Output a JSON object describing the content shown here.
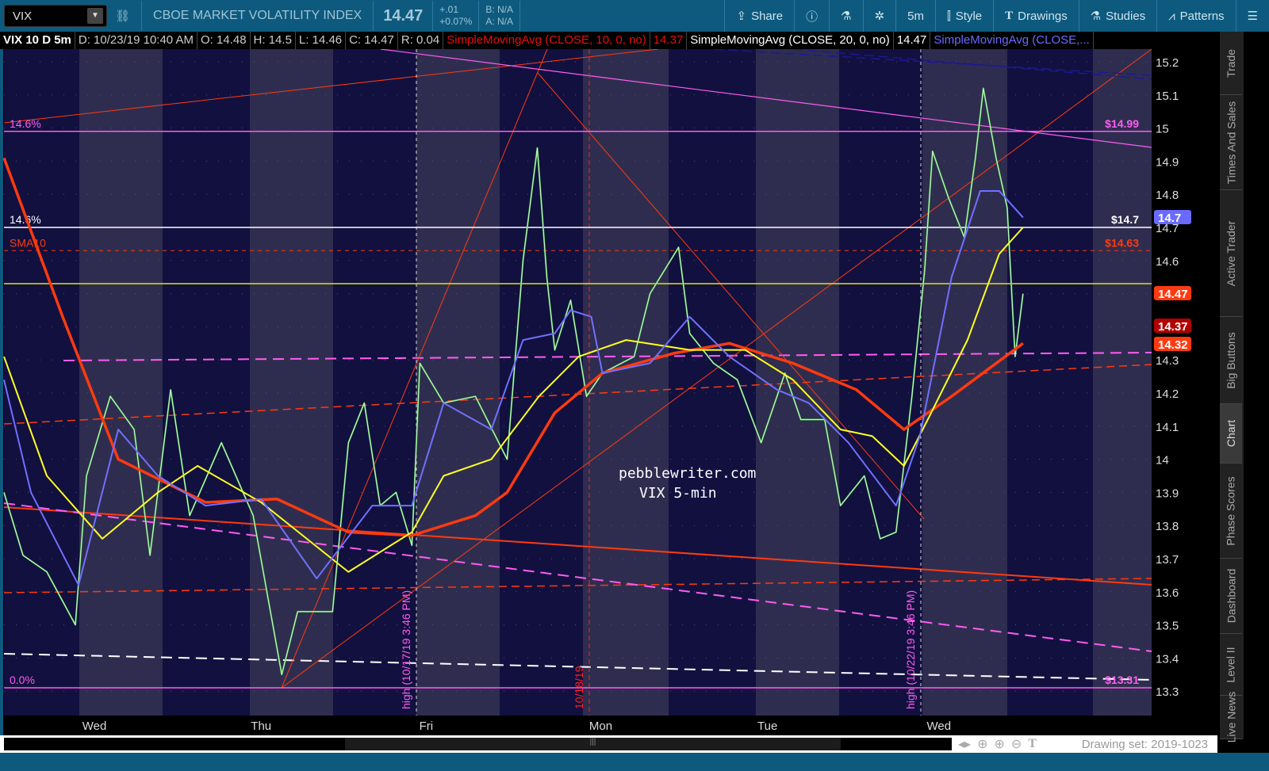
{
  "toolbar": {
    "symbol": "VIX",
    "name": "CBOE MARKET VOLATILITY INDEX",
    "last": "14.47",
    "change": "+.01",
    "change_pct": "+0.07%",
    "bid": "B: N/A",
    "ask": "A: N/A",
    "share": "Share",
    "interval": "5m",
    "style": "Style",
    "drawings": "Drawings",
    "studies": "Studies",
    "patterns": "Patterns"
  },
  "info": {
    "title": "VIX 10 D 5m",
    "date": "D: 10/23/19 10:40 AM",
    "open": "O: 14.48",
    "high": "H: 14.5",
    "low": "L: 14.46",
    "close": "C: 14.47",
    "range": "R: 0.04",
    "sma10": "SimpleMovingAvg (CLOSE, 10, 0, no)",
    "sma10_val": "14.37",
    "sma20": "SimpleMovingAvg (CLOSE, 20, 0, no)",
    "sma20_val": "14.47",
    "sma3": "SimpleMovingAvg (CLOSE,..."
  },
  "side_tabs": [
    "Trade",
    "Times And Sales",
    "Active Trader",
    "Big Buttons",
    "Chart",
    "Phase Scores",
    "Dashboard",
    "Level II",
    "Live News"
  ],
  "bottom": {
    "drawing_set": "Drawing set: 2019-1023"
  },
  "chart_data": {
    "type": "line",
    "title": "VIX 10 D 5m",
    "ylim": [
      13.25,
      15.25
    ],
    "yticks": [
      "15.2",
      "15.1",
      "15",
      "14.9",
      "14.8",
      "14.7",
      "14.6",
      "14.5",
      "14.4",
      "14.3",
      "14.2",
      "14.1",
      "14",
      "13.9",
      "13.8",
      "13.7",
      "13.6",
      "13.5",
      "13.4",
      "13.3"
    ],
    "xlabels": [
      {
        "bar": 57,
        "label": "Wed"
      },
      {
        "bar": 162,
        "label": "Thu"
      },
      {
        "bar": 266,
        "label": "Fri"
      },
      {
        "bar": 376,
        "label": "Mon"
      },
      {
        "bar": 481,
        "label": "Tue"
      },
      {
        "bar": 589,
        "label": "Wed"
      }
    ],
    "xmax": 723,
    "price": {
      "name": "VIX close",
      "color": "#3ac23a",
      "bars": [
        0,
        12,
        27,
        45,
        52,
        67,
        82,
        92,
        105,
        117,
        137,
        157,
        175,
        185,
        207,
        217,
        227,
        237,
        247,
        257,
        262,
        277,
        297,
        317,
        327,
        336,
        342,
        347,
        357,
        367,
        377,
        397,
        407,
        425,
        432,
        447,
        462,
        477,
        492,
        502,
        517,
        527,
        542,
        552,
        562,
        572,
        580,
        585,
        595,
        605,
        612,
        617,
        625,
        632,
        637,
        642
      ],
      "values": [
        13.9,
        13.71,
        13.66,
        13.5,
        13.95,
        14.19,
        14.09,
        13.71,
        14.21,
        13.83,
        14.05,
        13.83,
        13.35,
        13.54,
        13.54,
        14.05,
        14.17,
        13.86,
        13.9,
        13.74,
        14.29,
        14.17,
        14.19,
        14.0,
        14.6,
        14.94,
        14.55,
        14.33,
        14.48,
        14.19,
        14.26,
        14.31,
        14.5,
        14.64,
        14.38,
        14.29,
        14.24,
        14.05,
        14.26,
        14.12,
        14.12,
        13.86,
        13.95,
        13.76,
        13.78,
        14.19,
        14.57,
        14.93,
        14.79,
        14.67,
        14.91,
        15.12,
        14.91,
        14.76,
        14.31,
        14.5
      ]
    },
    "series": [
      {
        "name": "SMA50",
        "color": "#ff3a10",
        "bars": [
          0,
          37,
          72,
          127,
          172,
          217,
          257,
          297,
          317,
          347,
          377,
          422,
          457,
          497,
          537,
          567,
          597,
          642
        ],
        "values": [
          14.91,
          14.43,
          14.0,
          13.87,
          13.88,
          13.78,
          13.77,
          13.83,
          13.9,
          14.14,
          14.26,
          14.32,
          14.35,
          14.29,
          14.21,
          14.09,
          14.19,
          14.35
        ]
      },
      {
        "name": "SMA20",
        "color": "#ffff20",
        "bars": [
          0,
          27,
          62,
          97,
          122,
          162,
          217,
          257,
          277,
          307,
          337,
          362,
          392,
          432,
          467,
          497,
          527,
          547,
          567,
          582,
          607,
          627,
          642
        ],
        "values": [
          14.31,
          13.95,
          13.76,
          13.9,
          13.98,
          13.87,
          13.66,
          13.78,
          13.95,
          14.0,
          14.19,
          14.31,
          14.36,
          14.33,
          14.33,
          14.24,
          14.09,
          14.07,
          13.98,
          14.12,
          14.36,
          14.62,
          14.7
        ]
      },
      {
        "name": "SMA10",
        "color": "#7070ff",
        "bars": [
          0,
          17,
          47,
          72,
          97,
          127,
          162,
          197,
          232,
          257,
          277,
          307,
          327,
          347,
          357,
          370,
          377,
          407,
          432,
          457,
          487,
          507,
          532,
          562,
          577,
          597,
          615,
          627,
          642
        ],
        "values": [
          14.24,
          13.9,
          13.62,
          14.09,
          13.95,
          13.86,
          13.88,
          13.64,
          13.86,
          13.86,
          14.17,
          14.09,
          14.36,
          14.38,
          14.45,
          14.43,
          14.26,
          14.29,
          14.43,
          14.31,
          14.21,
          14.17,
          14.05,
          13.86,
          14.07,
          14.55,
          14.81,
          14.81,
          14.73
        ]
      }
    ],
    "levels": [
      {
        "price": 14.99,
        "left": "14.6%",
        "right": "$14.99",
        "color": "#ff5cf0"
      },
      {
        "price": 14.7,
        "left": "14.6%",
        "right": "$14.7",
        "color": "#ffffff"
      },
      {
        "price": 14.63,
        "left": "SMA10",
        "right": "$14.63",
        "color": "#ff3a10"
      },
      {
        "price": 14.53,
        "left": "",
        "right": "",
        "color": "#e0e020"
      },
      {
        "price": 13.31,
        "left": "0.0%",
        "right": "$13.31",
        "color": "#ff5cf0"
      }
    ],
    "badges": [
      {
        "value": "14.7",
        "color": "#6a6aff"
      },
      {
        "value": "14.47",
        "color": "#ff3a10"
      },
      {
        "value": "14.37",
        "color": "#b00000"
      },
      {
        "value": "14.32",
        "color": "#ff3a10"
      }
    ],
    "annotations": [
      "high (10/17/19 3:46 PM)",
      "10/18/19",
      "high (10/22/19 3:46 PM)",
      "pebblewriter.com",
      "VIX 5-min"
    ]
  }
}
